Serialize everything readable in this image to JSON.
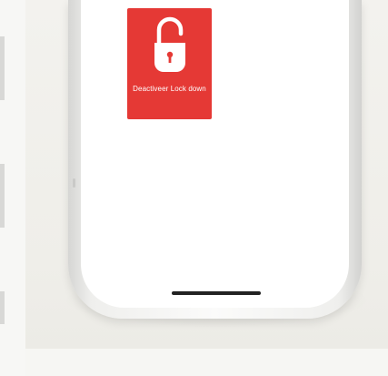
{
  "lock_tile": {
    "label": "Deactiveer Lock down",
    "icon": "padlock-open-icon",
    "color": "#e53935"
  },
  "colors": {
    "background": "#f1f0ec",
    "phone_frame": "#f4f4f2",
    "screen": "#ffffff",
    "home_indicator": "#222222"
  }
}
